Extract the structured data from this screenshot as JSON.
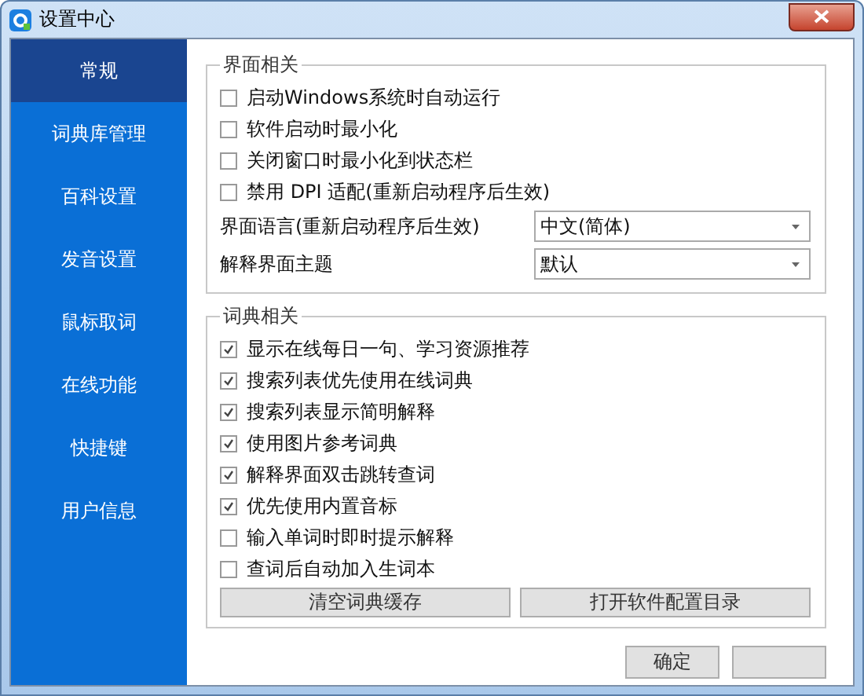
{
  "window": {
    "title": "设置中心"
  },
  "sidebar": {
    "items": [
      {
        "label": "常规",
        "selected": true
      },
      {
        "label": "词典库管理",
        "selected": false
      },
      {
        "label": "百科设置",
        "selected": false
      },
      {
        "label": "发音设置",
        "selected": false
      },
      {
        "label": "鼠标取词",
        "selected": false
      },
      {
        "label": "在线功能",
        "selected": false
      },
      {
        "label": "快捷键",
        "selected": false
      },
      {
        "label": "用户信息",
        "selected": false
      }
    ]
  },
  "interface_group": {
    "title": "界面相关",
    "options": [
      {
        "label": "启动Windows系统时自动运行",
        "checked": false
      },
      {
        "label": "软件启动时最小化",
        "checked": false
      },
      {
        "label": "关闭窗口时最小化到状态栏",
        "checked": false
      },
      {
        "label": "禁用 DPI 适配(重新启动程序后生效)",
        "checked": false
      }
    ],
    "selects": [
      {
        "label": "界面语言(重新启动程序后生效)",
        "value": "中文(简体)"
      },
      {
        "label": "解释界面主题",
        "value": "默认"
      }
    ]
  },
  "dictionary_group": {
    "title": "词典相关",
    "options": [
      {
        "label": "显示在线每日一句、学习资源推荐",
        "checked": true
      },
      {
        "label": "搜索列表优先使用在线词典",
        "checked": true
      },
      {
        "label": "搜索列表显示简明解释",
        "checked": true
      },
      {
        "label": "使用图片参考词典",
        "checked": true
      },
      {
        "label": "解释界面双击跳转查词",
        "checked": true
      },
      {
        "label": "优先使用内置音标",
        "checked": true
      },
      {
        "label": "输入单词时即时提示解释",
        "checked": false
      },
      {
        "label": "查词后自动加入生词本",
        "checked": false
      }
    ],
    "buttons": [
      "清空词典缓存",
      "打开软件配置目录"
    ]
  },
  "footer_buttons": [
    "确定"
  ]
}
